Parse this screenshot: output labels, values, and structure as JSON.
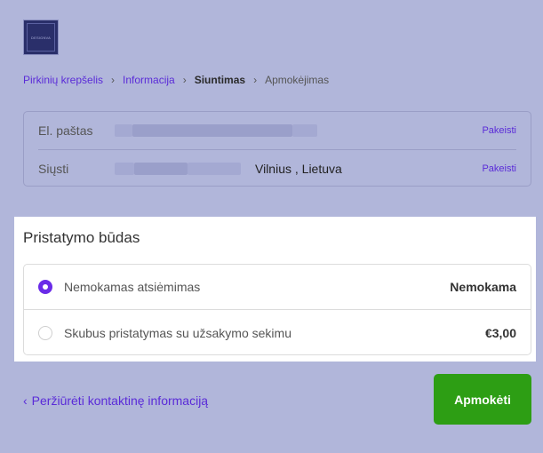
{
  "logo": {
    "text": "DESIGNVA"
  },
  "breadcrumbs": {
    "cart": "Pirkinių krepšelis",
    "information": "Informacija",
    "shipping": "Siuntimas",
    "payment": "Apmokėjimas",
    "separator": "›"
  },
  "contact": {
    "email_label": "El. paštas",
    "email_change": "Pakeisti",
    "ship_label": "Siųsti",
    "ship_location": "Vilnius , Lietuva",
    "ship_change": "Pakeisti"
  },
  "shipping": {
    "title": "Pristatymo būdas",
    "methods": [
      {
        "label": "Nemokamas atsiėmimas",
        "price": "Nemokama",
        "selected": true
      },
      {
        "label": "Skubus pristatymas su užsakymo sekimu",
        "price": "€3,00",
        "selected": false
      }
    ]
  },
  "footer": {
    "back_chevron": "‹",
    "back_label": "Peržiūrėti kontaktinę informaciją",
    "pay_label": "Apmokėti"
  },
  "colors": {
    "background": "#b1b6da",
    "accent": "#6a2be8",
    "link": "#5a2bd8",
    "pay_button": "#2d9e14"
  }
}
